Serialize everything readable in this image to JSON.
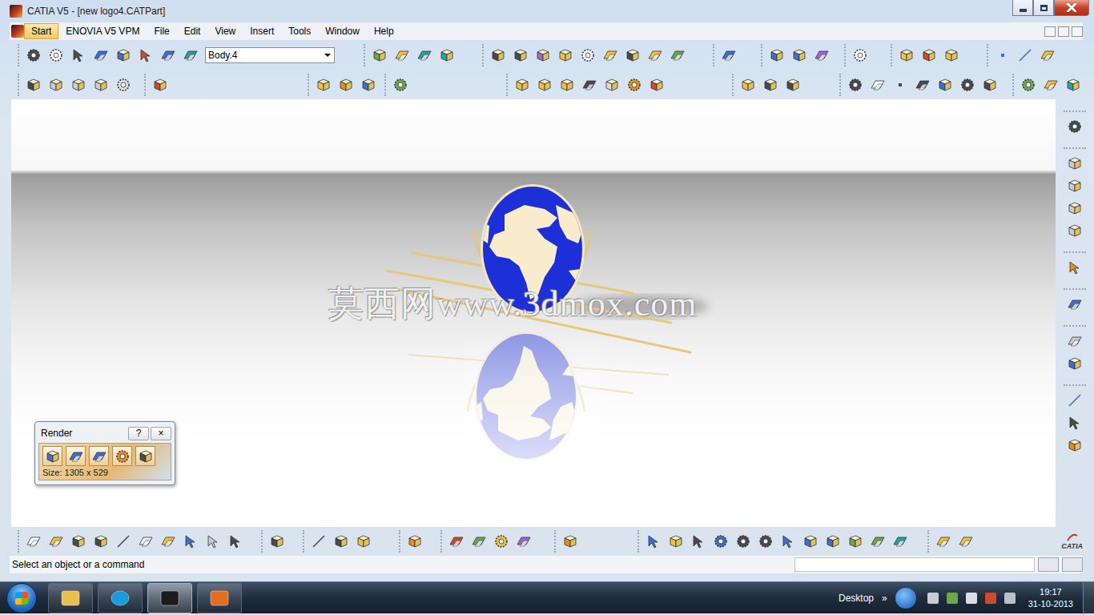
{
  "window": {
    "title": "CATIA V5 - [new logo4.CATPart]"
  },
  "menu": [
    {
      "label": "Start",
      "selected": true
    },
    {
      "label": "ENOVIA V5 VPM",
      "selected": false
    },
    {
      "label": "File",
      "selected": false
    },
    {
      "label": "Edit",
      "selected": false
    },
    {
      "label": "View",
      "selected": false
    },
    {
      "label": "Insert",
      "selected": false
    },
    {
      "label": "Tools",
      "selected": false
    },
    {
      "label": "Window",
      "selected": false
    },
    {
      "label": "Help",
      "selected": false
    }
  ],
  "toolbar": {
    "body_select": {
      "value": "Body.4"
    }
  },
  "viewport": {
    "watermark": "莫西网www.3dmox.com"
  },
  "render_panel": {
    "title": "Render",
    "help": "?",
    "close": "×",
    "size": "Size: 1305 x 529"
  },
  "status_bar": {
    "message": "Select an object or a command"
  },
  "logo": {
    "text": "CATIA"
  },
  "taskbar": {
    "desktop": "Desktop",
    "expand": "»",
    "time": "19:17",
    "date": "31-10-2013"
  }
}
